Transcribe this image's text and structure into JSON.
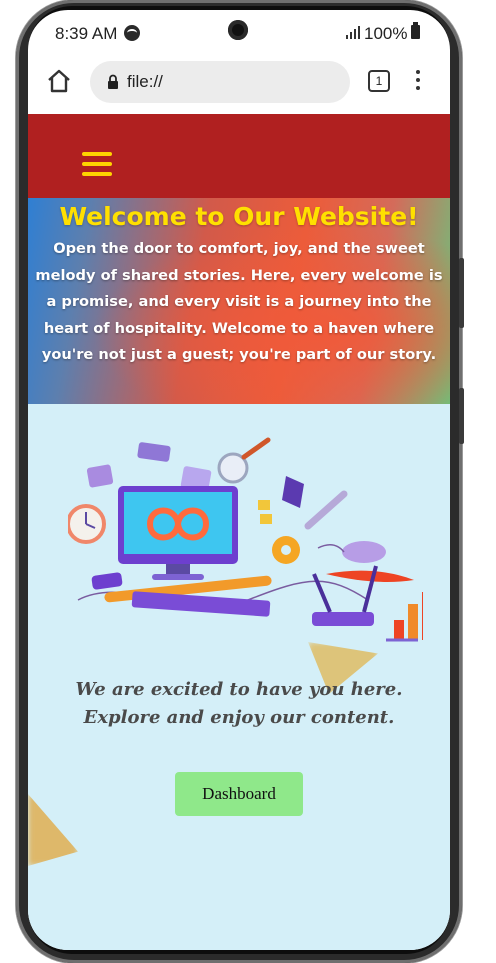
{
  "status_bar": {
    "time": "8:39 AM",
    "battery": "100%",
    "icons": [
      "spotify-icon",
      "signal-icon",
      "battery-icon"
    ]
  },
  "browser": {
    "url": "file://",
    "tab_count": "1",
    "icons": [
      "home-icon",
      "lock-icon",
      "tabs-icon",
      "menu-dots-icon"
    ]
  },
  "site": {
    "hero": {
      "title": "Welcome to Our Website!",
      "text": "Open the door to comfort, joy, and the sweet melody of shared stories. Here, every welcome is a promise, and every visit is a journey into the heart of hospitality. Welcome to a haven where you're not just a guest; you're part of our story."
    },
    "welcome_message": "We are excited to have you here. Explore and enjoy our content.",
    "dashboard_button": "Dashboard"
  },
  "colors": {
    "navbar": "#b02020",
    "hamburger": "#ffd400",
    "hero_title": "#ffe000",
    "content_bg": "#d4eff8",
    "button_bg": "#8fe88a"
  }
}
